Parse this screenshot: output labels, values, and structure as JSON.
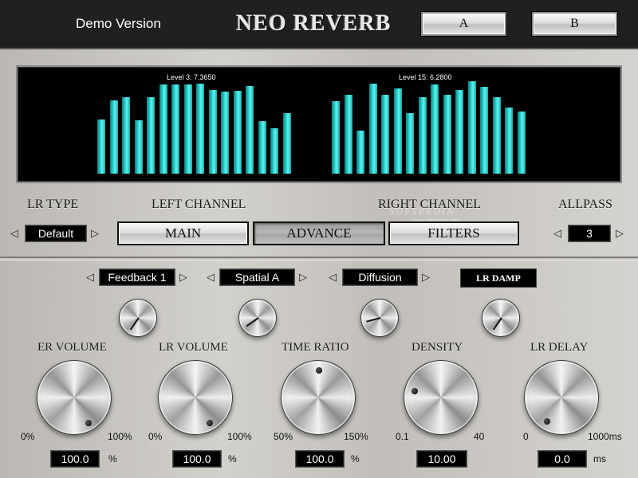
{
  "header": {
    "demo_label": "Demo Version",
    "title": "NEO REVERB",
    "preset_a": "A",
    "preset_b": "B"
  },
  "meter": {
    "left_label": "Level 3: 7.3650",
    "right_label": "Level 15: 6.2800",
    "left_levels": [
      0.58,
      0.78,
      0.81,
      0.57,
      0.81,
      0.95,
      0.95,
      0.95,
      0.96,
      0.89,
      0.87,
      0.88,
      0.93,
      0.56,
      0.48,
      0.64
    ],
    "right_levels": [
      0.77,
      0.84,
      0.46,
      0.96,
      0.84,
      0.91,
      0.64,
      0.81,
      0.95,
      0.84,
      0.89,
      0.98,
      0.92,
      0.81,
      0.7,
      0.66
    ],
    "bar_color": "#2ad6d2"
  },
  "labels": {
    "lr_type": "LR TYPE",
    "left_channel": "LEFT CHANNEL",
    "right_channel": "RIGHT CHANNEL",
    "allpass": "ALLPASS"
  },
  "lr_type_value": "Default",
  "allpass_value": "3",
  "tabs": {
    "main": "MAIN",
    "advance": "ADVANCE",
    "filters": "FILTERS"
  },
  "watermark": {
    "text": "SOFTPEDIA",
    "url": "www.softpedia.com"
  },
  "selectors": {
    "feedback": "Feedback 1",
    "spatial": "Spatial A",
    "diffusion": "Diffusion",
    "lr_damp": "LR DAMP"
  },
  "controls": [
    {
      "label": "ER VOLUME",
      "min": "0%",
      "max": "100%",
      "value": "100.0",
      "unit": "%"
    },
    {
      "label": "LR VOLUME",
      "min": "0%",
      "max": "100%",
      "value": "100.0",
      "unit": "%"
    },
    {
      "label": "TIME RATIO",
      "min": "50%",
      "max": "150%",
      "value": "100.0",
      "unit": "%"
    },
    {
      "label": "DENSITY",
      "min": "0.1",
      "max": "40",
      "value": "10.00",
      "unit": ""
    },
    {
      "label": "LR DELAY",
      "min": "0",
      "max": "1000ms",
      "value": "0.0",
      "unit": "ms"
    }
  ],
  "icons": {
    "arrow_left": "◁",
    "arrow_right": "▷"
  }
}
